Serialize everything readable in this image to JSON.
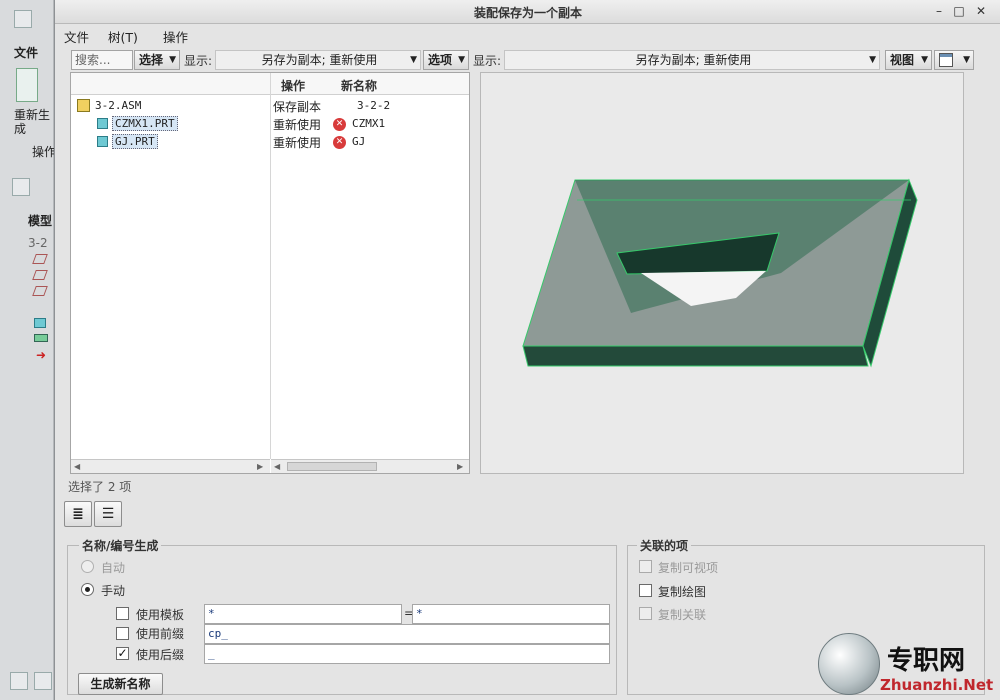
{
  "background_app": {
    "menu_file": "文件",
    "regenerate": "重新生成",
    "operations": "操作",
    "model_tab": "模型",
    "tree_item": "3-2"
  },
  "dialog": {
    "title": "装配保存为一个副本",
    "menu": {
      "file": "文件",
      "tree": "树(T)",
      "ops": "操作"
    },
    "left_toolbar": {
      "search_placeholder": "搜索...",
      "select_label": "选择",
      "display_label": "显示:",
      "display_value": "另存为副本; 重新使用",
      "options_label": "选项"
    },
    "right_toolbar": {
      "display_label": "显示:",
      "display_value": "另存为副本; 重新使用",
      "view_label": "视图"
    },
    "table": {
      "headers": {
        "operation": "操作",
        "new_name": "新名称"
      },
      "rows": [
        {
          "name": "3-2.ASM",
          "type": "asm",
          "operation": "保存副本",
          "new_name": "3-2-2",
          "error": false
        },
        {
          "name": "CZMX1.PRT",
          "type": "prt",
          "operation": "重新使用",
          "new_name": "CZMX1",
          "error": true
        },
        {
          "name": "GJ.PRT",
          "type": "prt",
          "operation": "重新使用",
          "new_name": "GJ",
          "error": true
        }
      ]
    },
    "status": "选择了 2 项",
    "naming": {
      "title": "名称/编号生成",
      "auto": "自动",
      "manual": "手动",
      "mode": "manual",
      "use_template": {
        "label": "使用模板",
        "checked": false,
        "left_value": "*",
        "right_value": "*",
        "equals": "="
      },
      "use_prefix": {
        "label": "使用前缀",
        "checked": false,
        "value": "cp_"
      },
      "use_suffix": {
        "label": "使用后缀",
        "checked": true,
        "value": "_"
      },
      "generate_button": "生成新名称"
    },
    "related": {
      "title": "关联的项",
      "copy_visible": {
        "label": "复制可视项",
        "checked": false,
        "enabled": false
      },
      "copy_drawing": {
        "label": "复制绘图",
        "checked": false,
        "enabled": true
      },
      "copy_relations": {
        "label": "复制关联",
        "checked": false,
        "enabled": false
      }
    }
  },
  "watermark": {
    "cn": "专职网",
    "en": "Zhuanzhi.Net"
  },
  "colors": {
    "model_green": "#2f6e52",
    "model_edge": "#36c96a",
    "dialog_bg": "#e4e4e4"
  }
}
